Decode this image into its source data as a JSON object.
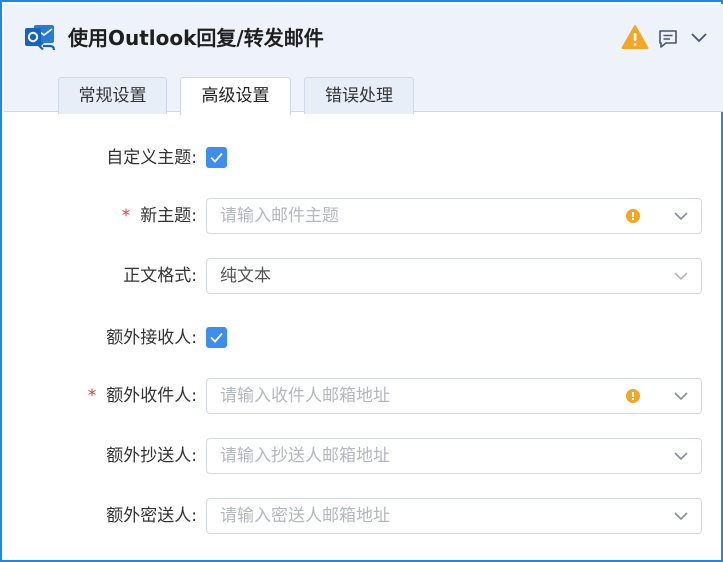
{
  "header": {
    "title": "使用Outlook回复/转发邮件",
    "icons": [
      "outlook-icon",
      "warning-icon",
      "message-icon",
      "chevron-down-icon"
    ]
  },
  "tabs": [
    {
      "label": "常规设置",
      "active": false
    },
    {
      "label": "高级设置",
      "active": true
    },
    {
      "label": "错误处理",
      "active": false
    }
  ],
  "form": {
    "custom_subject": {
      "label": "自定义主题:",
      "checked": true
    },
    "new_subject": {
      "required": "*",
      "label": "新主题:",
      "placeholder": "请输入邮件主题",
      "has_warning": true
    },
    "body_format": {
      "label": "正文格式:",
      "value": "纯文本"
    },
    "extra_recipients_toggle": {
      "label": "额外接收人:",
      "checked": true
    },
    "extra_to": {
      "required": "*",
      "label": "额外收件人:",
      "placeholder": "请输入收件人邮箱地址",
      "has_warning": true
    },
    "extra_cc": {
      "label": "额外抄送人:",
      "placeholder": "请输入抄送人邮箱地址"
    },
    "extra_bcc": {
      "label": "额外密送人:",
      "placeholder": "请输入密送人邮箱地址"
    }
  },
  "colors": {
    "accent": "#3d8ef0",
    "frame_border": "#1e88e5",
    "required": "#e53935",
    "warning": "#f5a623"
  }
}
